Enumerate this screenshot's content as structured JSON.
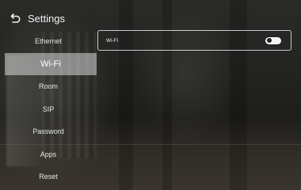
{
  "header": {
    "title": "Settings"
  },
  "sidebar": {
    "items": [
      {
        "label": "Ethernet"
      },
      {
        "label": "Wi-Fi"
      },
      {
        "label": "Room"
      },
      {
        "label": "SIP"
      },
      {
        "label": "Password"
      },
      {
        "label": "Apps"
      },
      {
        "label": "Reset"
      }
    ],
    "selected_index": 1
  },
  "main": {
    "wifi_row": {
      "label": "Wi-Fi",
      "toggle_on": false
    }
  }
}
